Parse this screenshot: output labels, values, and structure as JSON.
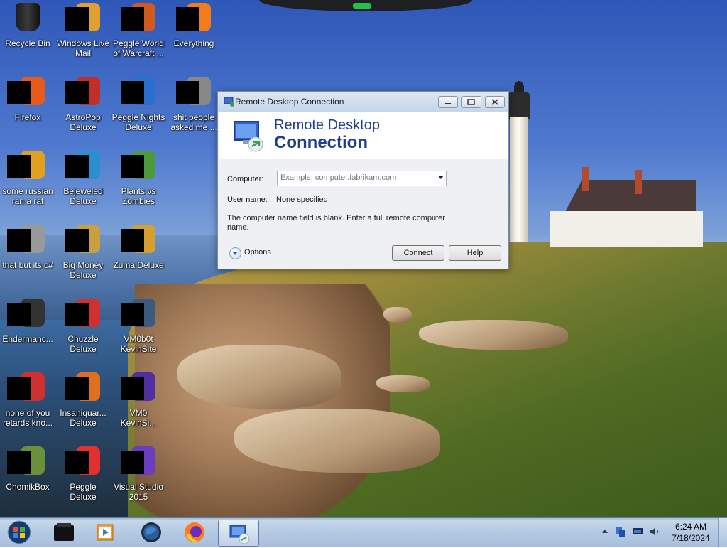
{
  "desktop": {
    "icons": [
      {
        "label": "Recycle Bin",
        "icon": "recycle-bin-icon"
      },
      {
        "label": "Windows Live Mail",
        "icon": "windows-live-mail-icon"
      },
      {
        "label": "Peggle World of Warcraft ...",
        "icon": "peggle-wow-icon"
      },
      {
        "label": "Everything",
        "icon": "everything-search-icon"
      },
      {
        "label": "Firefox",
        "icon": "firefox-icon"
      },
      {
        "label": "AstroPop Deluxe",
        "icon": "astropop-icon"
      },
      {
        "label": "Peggle Nights Deluxe",
        "icon": "peggle-nights-icon"
      },
      {
        "label": "shit people asked me ...",
        "icon": "folder-icon"
      },
      {
        "label": "some russian ran a rat",
        "icon": "app-icon"
      },
      {
        "label": "Bejeweled Deluxe",
        "icon": "bejeweled-icon"
      },
      {
        "label": "Plants vs Zombies",
        "icon": "plants-vs-zombies-icon"
      },
      {
        "label": "that but its c#",
        "icon": "files-icon"
      },
      {
        "label": "Big Money Deluxe",
        "icon": "big-money-icon"
      },
      {
        "label": "Zuma Deluxe",
        "icon": "zuma-icon"
      },
      {
        "label": "Endermanc...",
        "icon": "terminal-icon"
      },
      {
        "label": "Chuzzle Deluxe",
        "icon": "chuzzle-icon"
      },
      {
        "label": "VM0b0t KevinSite",
        "icon": "vm-icon"
      },
      {
        "label": "none of you retards kno...",
        "icon": "app-icon"
      },
      {
        "label": "Insaniquar... Deluxe",
        "icon": "insaniquarium-icon"
      },
      {
        "label": "VM0 KevinSi...",
        "icon": "vm-icon"
      },
      {
        "label": "ChomikBox",
        "icon": "chomikbox-icon"
      },
      {
        "label": "Peggle Deluxe",
        "icon": "peggle-icon"
      },
      {
        "label": "Visual Studio 2015",
        "icon": "visual-studio-icon"
      }
    ]
  },
  "rdc": {
    "title": "Remote Desktop Connection",
    "banner_line1": "Remote Desktop",
    "banner_line2": "Connection",
    "computer_label": "Computer:",
    "computer_placeholder": "Example: computer.fabrikam.com",
    "username_label": "User name:",
    "username_value": "None specified",
    "message": "The computer name field is blank. Enter a full remote computer name.",
    "options_label": "Options",
    "connect_label": "Connect",
    "help_label": "Help"
  },
  "taskbar": {
    "items": [
      "start-orb-icon",
      "black-box-app-icon",
      "media-player-icon",
      "globe-icon",
      "firefox-icon",
      "remote-desktop-icon"
    ],
    "tray": [
      "show-hidden-icons-arrow-icon",
      "network-icon",
      "display-icon",
      "volume-icon"
    ],
    "time": "6:24 AM",
    "date": "7/18/2024"
  },
  "colors": {
    "banner_title": "#1d3f8c",
    "taskbar": "#b4c9e2",
    "window_bg": "#eef0f3"
  }
}
